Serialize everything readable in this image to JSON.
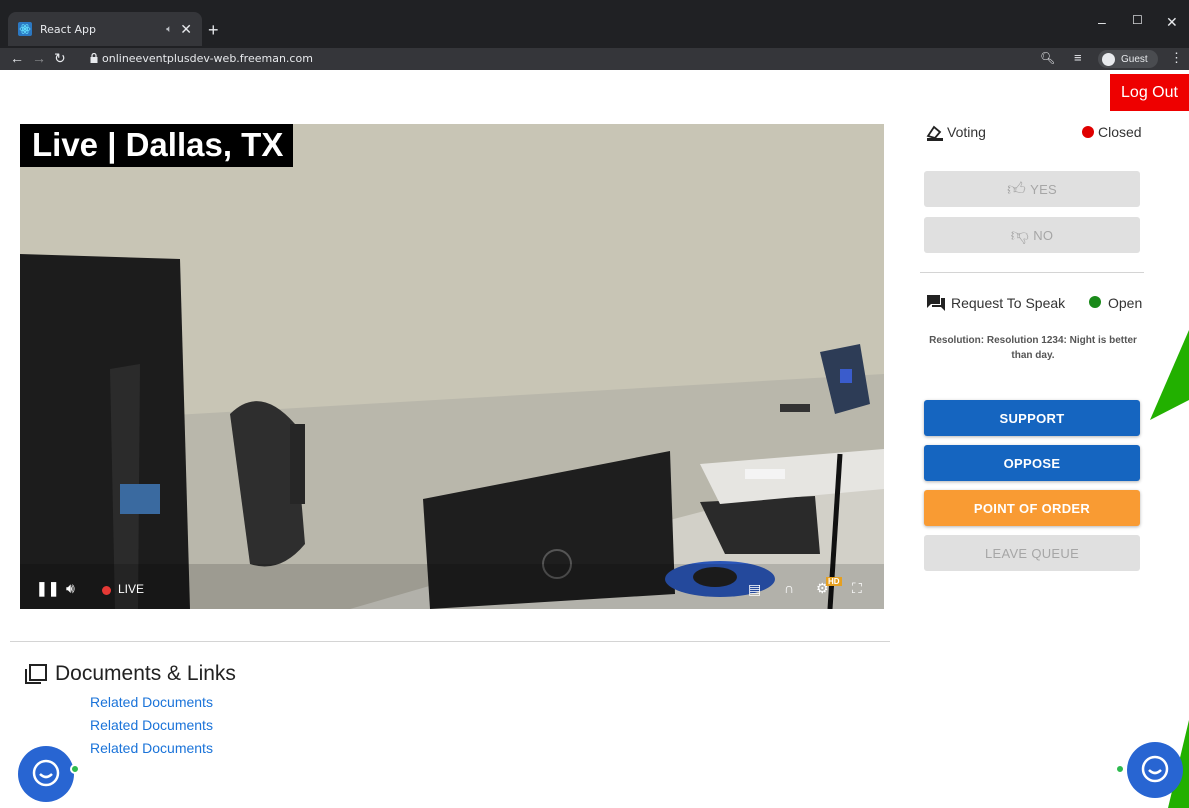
{
  "browser": {
    "tab_title": "React App",
    "url": "onlineeventplusdev-web.freeman.com",
    "profile_label": "Guest"
  },
  "header": {
    "logout_label": "Log Out"
  },
  "video": {
    "banner_text": "Live | Dallas, TX",
    "live_label": "LIVE",
    "hd_badge": "HD"
  },
  "voting": {
    "label": "Voting",
    "status": "Closed",
    "status_color": "#e00000",
    "yes_label": "YES",
    "no_label": "NO"
  },
  "request_to_speak": {
    "label": "Request To Speak",
    "status": "Open",
    "status_color": "#1a8a1a",
    "resolution_text": "Resolution: Resolution 1234: Night is better than day.",
    "support_label": "SUPPORT",
    "oppose_label": "OPPOSE",
    "point_of_order_label": "POINT OF ORDER",
    "leave_queue_label": "LEAVE QUEUE"
  },
  "documents": {
    "title": "Documents & Links",
    "links": [
      "Related Documents",
      "Related Documents",
      "Related Documents"
    ]
  },
  "colors": {
    "logout_bg": "#ee0000",
    "primary_blue": "#1565c0",
    "orange": "#f99b33",
    "link_blue": "#1a73d9",
    "annotation_green": "#22b000"
  }
}
